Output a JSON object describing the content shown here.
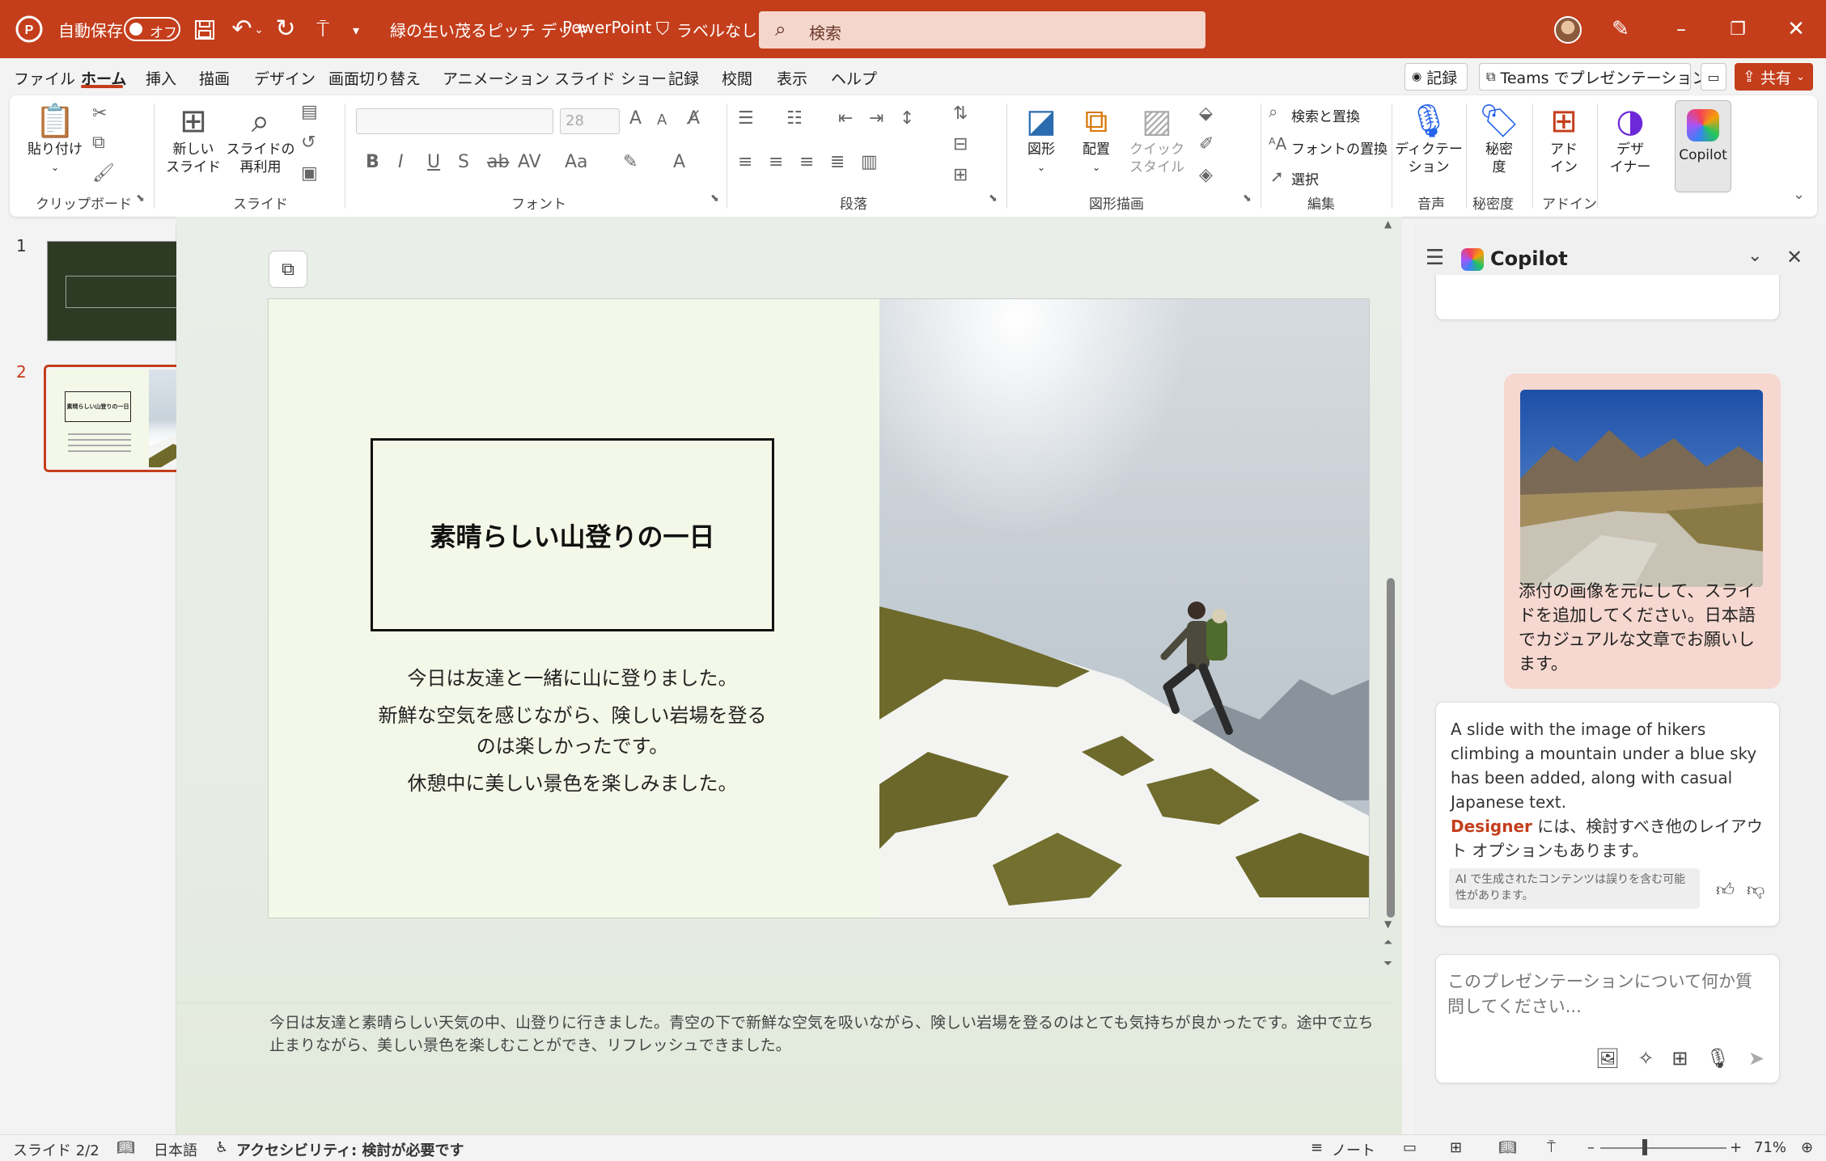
{
  "titlebar": {
    "autosave_label": "自動保存",
    "autosave_state": "オフ",
    "doc_title": "緑の生い茂るピッチ デッキ",
    "app_name": "PowerPoint",
    "sensitivity": "ラベルなし",
    "search_placeholder": "検索"
  },
  "tabs": [
    "ファイル",
    "ホーム",
    "挿入",
    "描画",
    "デザイン",
    "画面切り替え",
    "アニメーション",
    "スライド ショー",
    "記録",
    "校閲",
    "表示",
    "ヘルプ"
  ],
  "topbuttons": {
    "record": "記録",
    "teams": "Teams でプレゼンテーション",
    "share": "共有"
  },
  "ribbon": {
    "paste": "貼り付け",
    "new_slide": "新しい\nスライド",
    "reuse_slides": "スライドの\n再利用",
    "font_size": "28",
    "shapes": "図形",
    "arrange": "配置",
    "quick_styles": "クイック\nスタイル",
    "find_replace": "検索と置換",
    "replace_font": "フォントの置換",
    "select": "選択",
    "dictate": "ディクテー\nション",
    "sensitivity": "秘密\n度",
    "addins": "アド\nイン",
    "designer": "デザ\nイナー",
    "copilot": "Copilot",
    "groups": {
      "clipboard": "クリップボード",
      "slides": "スライド",
      "font": "フォント",
      "paragraph": "段落",
      "drawing": "図形描画",
      "editing": "編集",
      "voice": "音声",
      "sensitivity": "秘密度",
      "addins": "アドイン"
    }
  },
  "thumbnails": {
    "n1": "1",
    "n2": "2",
    "t2_title": "素晴らしい山登りの一日"
  },
  "slide": {
    "title": "素晴らしい山登りの一日",
    "body": [
      "今日は友達と一緒に山に登りました。",
      "新鮮な空気を感じながら、険しい岩場を登るのは楽しかったです。",
      "休憩中に美しい景色を楽しみました。"
    ]
  },
  "notes": "今日は友達と素晴らしい天気の中、山登りに行きました。青空の下で新鮮な空気を吸いながら、険しい岩場を登るのはとても気持ちが良かったです。途中で立ち止まりながら、美しい景色を楽しむことができ、リフレッシュできました。",
  "copilot": {
    "title": "Copilot",
    "user_message": "添付の画像を元にして、スライドを追加してください。日本語でカジュアルな文章でお願いします。",
    "ai_message_en": "A slide with the image of hikers climbing a mountain under a blue sky has been added, along with casual Japanese text.",
    "ai_designer": "Designer",
    "ai_message_jp": " には、検討すべき他のレイアウト オプションもあります。",
    "disclaimer": "AI で生成されたコンテンツは誤りを含む可能性があります。",
    "input_placeholder": "このプレゼンテーションについて何か質問してください..."
  },
  "statusbar": {
    "slide_info": "スライド 2/2",
    "language": "日本語",
    "accessibility": "アクセシビリティ: 検討が必要です",
    "notes": "ノート",
    "zoom": "71%"
  },
  "colors": {
    "accent": "#c43e1c",
    "slide_bg": "#f4f8e8",
    "thumb1_bg": "#2e3b24"
  }
}
